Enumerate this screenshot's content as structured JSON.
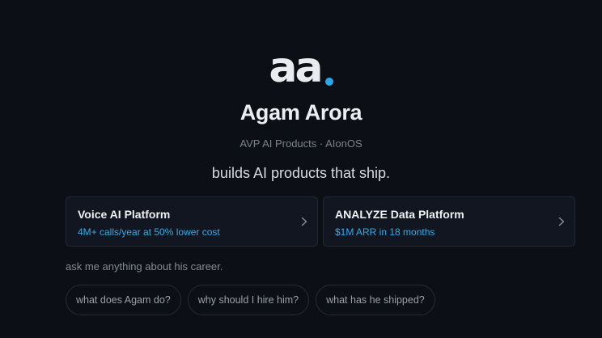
{
  "logo": {
    "text": "aa",
    "dot_color": "#2ea7e6"
  },
  "profile": {
    "name": "Agam Arora",
    "role": "AVP AI Products · AIonOS",
    "tagline": "builds AI products that ship."
  },
  "cards": [
    {
      "title": "Voice AI Platform",
      "subtitle": "4M+ calls/year at 50% lower cost",
      "icon": "chevron-right-icon"
    },
    {
      "title": "ANALYZE Data Platform",
      "subtitle": "$1M ARR in 18 months",
      "icon": "chevron-right-icon"
    }
  ],
  "chat": {
    "prompt": "ask me anything about his career.",
    "suggestions": [
      "what does Agam do?",
      "why should I hire him?",
      "what has he shipped?"
    ]
  },
  "colors": {
    "background": "#0c0f15",
    "accent": "#3aa9e6",
    "card_background": "#121620"
  }
}
